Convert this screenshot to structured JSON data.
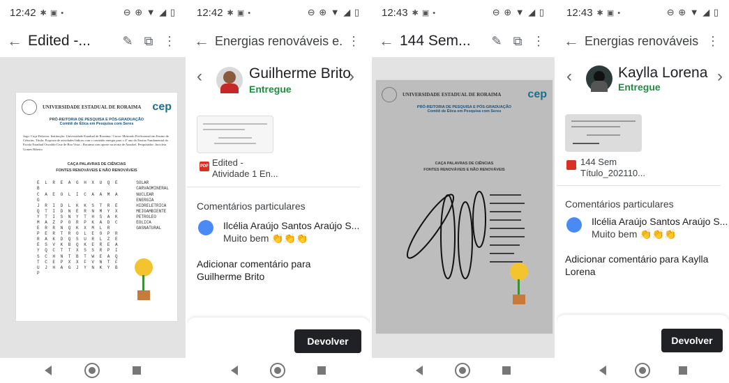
{
  "screens": [
    {
      "status": {
        "time": "12:42",
        "icons": "✱ ▣ •",
        "right": "⊖ ⊕ ▼ ◢ ▯"
      },
      "title": "Edited -...",
      "document": {
        "university": "UNIVERSIDADE ESTADUAL DE RORAIMA",
        "brand": "cep",
        "sub1": "PRÓ-REITORIA DE PESQUISA E PÓS-GRADUAÇÃO",
        "sub2": "Comitê de Ética em Pesquisa com Seres",
        "info": "Jogo: Caça-Palavras. Instituição: Universidade Estadual de Roraima / Curso: Mestrado Profissional em Ensino de Ciências. Título: Proposta de atividades lúdicas com o conteúdo energia para o 4º ano do Ensino Fundamental da Escola Estadual Oswaldo Cruz de Boa Vista – Roraima com aporte na teoria de Ausubel. Pesquisador: Jucicleia Gomes Ribeiro",
        "game_title1": "CAÇA PALAVRAS DE CIÊNCIAS",
        "game_title2": "FONTES RENOVÁVEIS E NÃO RENOVÁVEIS",
        "grid": [
          "ELREAGHXUQEB",
          "CAEOLICAAMAG",
          "JRIDLKKSTRE",
          "QTIDNERNMYX",
          "YTISNYTHSAK",
          "MAZPORPKADC",
          "ERRNQKXMLR",
          "PERTROLEOPR",
          "RAKDQSURLZE",
          "ESVKBQKEREA",
          "YQCTTXSSRPI",
          "SCHNTBTWEAQ",
          "TCEPXXFVNTF",
          "UJHAGJYNKYBP"
        ],
        "words": [
          "SOLAR",
          "CARVAOMINERAL",
          "NUCLEAR",
          "ENERGIA",
          "HIDRELETRICA",
          "MEIOAMBIENTE",
          "PETROLEO",
          "EOLICA",
          "GASNATURAL"
        ]
      }
    },
    {
      "status": {
        "time": "12:42",
        "icons": "✱ ▣ •",
        "right": "⊖ ⊕ ▼ ◢ ▯"
      },
      "title": "Energias renováveis e...",
      "student": "Guilherme Brito",
      "state": "Entregue",
      "file": {
        "line1": "Edited -",
        "line2": "Atividade 1 En...",
        "type": "PDF"
      },
      "section": "Comentários particulares",
      "comment": {
        "author": "Ilcélia Araújo Santos Araújo S...",
        "text": "Muito bem",
        "emoji": "👏👏👏"
      },
      "add_comment": "Adicionar comentário para Guilherme Brito",
      "button": "Devolver"
    },
    {
      "status": {
        "time": "12:43",
        "icons": "✱ ▣ •",
        "right": "⊖ ⊕ ▼ ◢ ▯"
      },
      "title": "144 Sem...",
      "document": {
        "university": "UNIVERSIDADE ESTADUAL DE RORAIMA",
        "brand": "cep",
        "sub1": "PRÓ-REITORIA DE PESQUISA E PÓS-GRADUAÇÃO",
        "sub2": "Comitê de Ética em Pesquisa com Seres",
        "game_title1": "CAÇA PALAVRAS DE CIÊNCIAS",
        "game_title2": "FONTES RENOVÁVEIS E NÃO RENOVÁVEIS"
      }
    },
    {
      "status": {
        "time": "12:43",
        "icons": "✱ ▣ •",
        "right": "⊖ ⊕ ▼ ◢ ▯"
      },
      "title": "Energias renováveis e...",
      "student": "Kaylla Lorena",
      "state": "Entregue",
      "file": {
        "line1": "144 Sem",
        "line2": "Título_202110..."
      },
      "section": "Comentários particulares",
      "comment": {
        "author": "Ilcélia Araújo Santos Araújo S...",
        "text": "Muito bem",
        "emoji": "👏👏👏"
      },
      "add_comment": "Adicionar comentário para Kaylla Lorena",
      "button": "Devolver"
    }
  ]
}
